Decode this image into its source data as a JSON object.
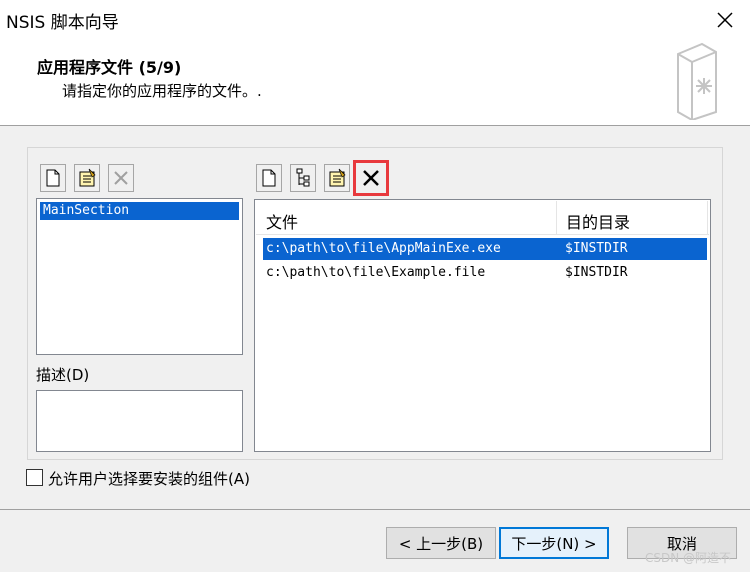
{
  "window": {
    "title": "NSIS 脚本向导"
  },
  "header": {
    "title": "应用程序文件 (5/9)",
    "subtitle": "请指定你的应用程序的文件。."
  },
  "sections": {
    "items": [
      {
        "label": "MainSection",
        "selected": true
      }
    ],
    "toolbar": [
      "new-file-icon",
      "wizard-icon",
      "delete-icon"
    ]
  },
  "description": {
    "label": "描述(D)",
    "value": ""
  },
  "files": {
    "toolbar": [
      "new-file-icon",
      "tree-icon",
      "wizard-icon",
      "delete-icon"
    ],
    "columns": [
      "文件",
      "目的目录"
    ],
    "rows": [
      {
        "file": "c:\\path\\to\\file\\AppMainExe.exe",
        "dest": "$INSTDIR",
        "selected": true
      },
      {
        "file": "c:\\path\\to\\file\\Example.file",
        "dest": "$INSTDIR",
        "selected": false
      }
    ]
  },
  "options": {
    "allow_select_label": "允许用户选择要安装的组件(A)",
    "allow_select_checked": false
  },
  "buttons": {
    "back": "< 上一步(B)",
    "next": "下一步(N) >",
    "cancel": "取消"
  },
  "watermark": "CSDN @阿造不",
  "colors": {
    "selection": "#0a64d0",
    "highlight_box": "#e8393d"
  }
}
